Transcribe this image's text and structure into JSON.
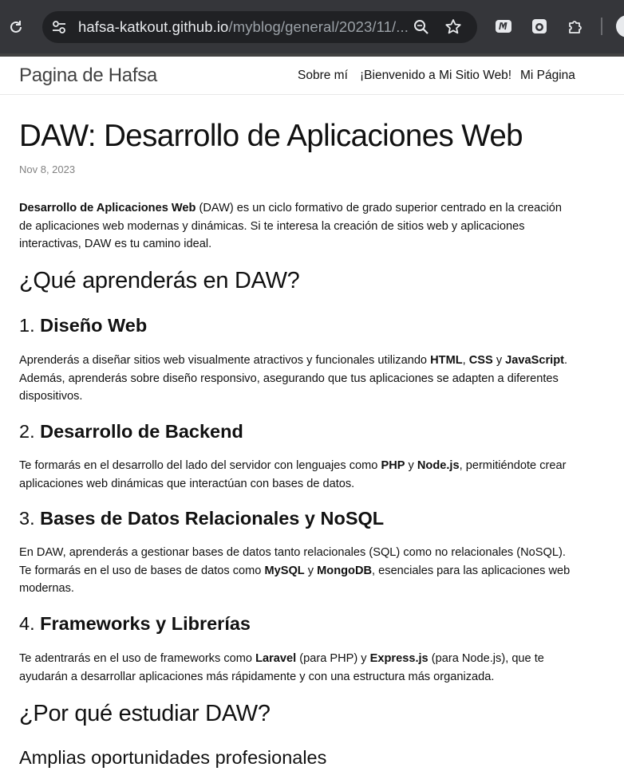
{
  "browser": {
    "url_host": "hafsa-katkout.github.io",
    "url_path": "/myblog/general/2023/11/..."
  },
  "site": {
    "title": "Pagina de Hafsa",
    "nav": [
      "Sobre mí",
      "¡Bienvenido a Mi Sitio Web!",
      "Mi Página"
    ]
  },
  "post": {
    "title": "DAW: Desarrollo de Aplicaciones Web",
    "date": "Nov 8, 2023",
    "intro_bold": "Desarrollo de Aplicaciones Web",
    "intro_rest": " (DAW) es un ciclo formativo de grado superior centrado en la creación de aplicaciones web modernas y dinámicas. Si te interesa la creación de sitios web y aplicaciones interactivas, DAW es tu camino ideal.",
    "h2_learn": "¿Qué aprenderás en DAW?",
    "sections": [
      {
        "num": "1. ",
        "title": "Diseño Web",
        "p1": "Aprenderás a diseñar sitios web visualmente atractivos y funcionales utilizando ",
        "b1": "HTML",
        "p2": ", ",
        "b2": "CSS",
        "p3": " y ",
        "b3": "JavaScript",
        "p4": ". Además, aprenderás sobre diseño responsivo, asegurando que tus aplicaciones se adapten a diferentes dispositivos."
      },
      {
        "num": "2. ",
        "title": "Desarrollo de Backend",
        "p1": "Te formarás en el desarrollo del lado del servidor con lenguajes como ",
        "b1": "PHP",
        "p2": " y ",
        "b2": "Node.js",
        "p3": ", permitiéndote crear aplicaciones web dinámicas que interactúan con bases de datos."
      },
      {
        "num": "3. ",
        "title": "Bases de Datos Relacionales y NoSQL",
        "p1": "En DAW, aprenderás a gestionar bases de datos tanto relacionales (SQL) como no relacionales (NoSQL). Te formarás en el uso de bases de datos como ",
        "b1": "MySQL",
        "p2": " y ",
        "b2": "MongoDB",
        "p3": ", esenciales para las aplicaciones web modernas."
      },
      {
        "num": "4. ",
        "title": "Frameworks y Librerías",
        "p1": "Te adentrarás en el uso de frameworks como ",
        "b1": "Laravel",
        "p2": " (para PHP) y ",
        "b2": "Express.js",
        "p3": " (para Node.js), que te ayudarán a desarrollar aplicaciones más rápidamente y con una estructura más organizada."
      }
    ],
    "h2_why": "¿Por qué estudiar DAW?",
    "h3_opportunities": "Amplias oportunidades profesionales"
  }
}
